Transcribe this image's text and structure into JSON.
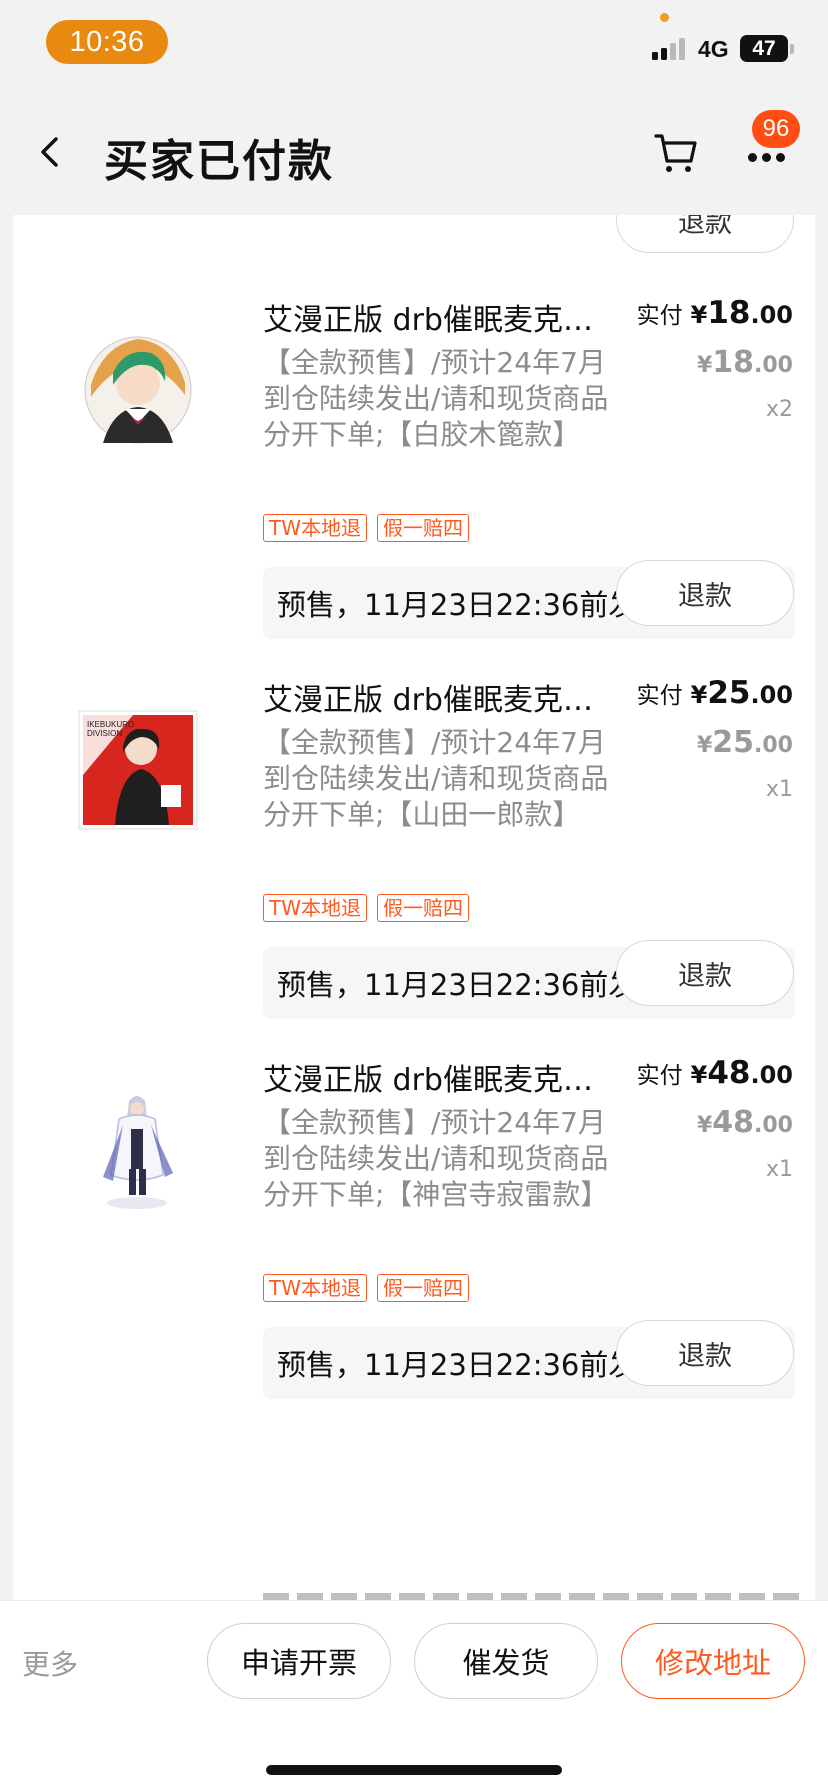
{
  "status_bar": {
    "time": "10:36",
    "network": "4G",
    "battery": "47"
  },
  "nav": {
    "title": "买家已付款",
    "cart_badge": "96"
  },
  "refund_label": "退款",
  "tag_labels": [
    "TW本地退",
    "假一赔四"
  ],
  "paid_label": "实付",
  "currency": "¥",
  "items": [
    {
      "title": "艾漫正版 drb催眠麦克风 …",
      "desc": "【全款预售】/预计24年7月到仓陆续发出/请和现货商品分开下单;【白胶木篦款】",
      "paid_int": "18",
      "paid_dec": ".00",
      "orig_int": "18",
      "orig_dec": ".00",
      "qty": "x2",
      "ship": "预售，11月23日22:36前发货",
      "thumb": "badge-character-green-hair"
    },
    {
      "title": "艾漫正版 drb催眠麦克风 …",
      "desc": "【全款预售】/预计24年7月到仓陆续发出/请和现货商品分开下单;【山田一郎款】",
      "paid_int": "25",
      "paid_dec": ".00",
      "orig_int": "25",
      "orig_dec": ".00",
      "qty": "x1",
      "ship": "预售，11月23日22:36前发货",
      "thumb": "card-character-red",
      "thumb_text": [
        "IKEBUKURO",
        "DIVISION"
      ]
    },
    {
      "title": "艾漫正版 drb催眠麦克风 …",
      "desc": "【全款预售】/预计24年7月到仓陆续发出/请和现货商品分开下单;【神宫寺寂雷款】",
      "paid_int": "48",
      "paid_dec": ".00",
      "orig_int": "48",
      "orig_dec": ".00",
      "qty": "x1",
      "ship": "预售，11月23日22:36前发货",
      "thumb": "acrylic-stand-character"
    }
  ],
  "bottom_bar": {
    "more": "更多",
    "invoice": "申请开票",
    "urge": "催发货",
    "change_address": "修改地址"
  }
}
